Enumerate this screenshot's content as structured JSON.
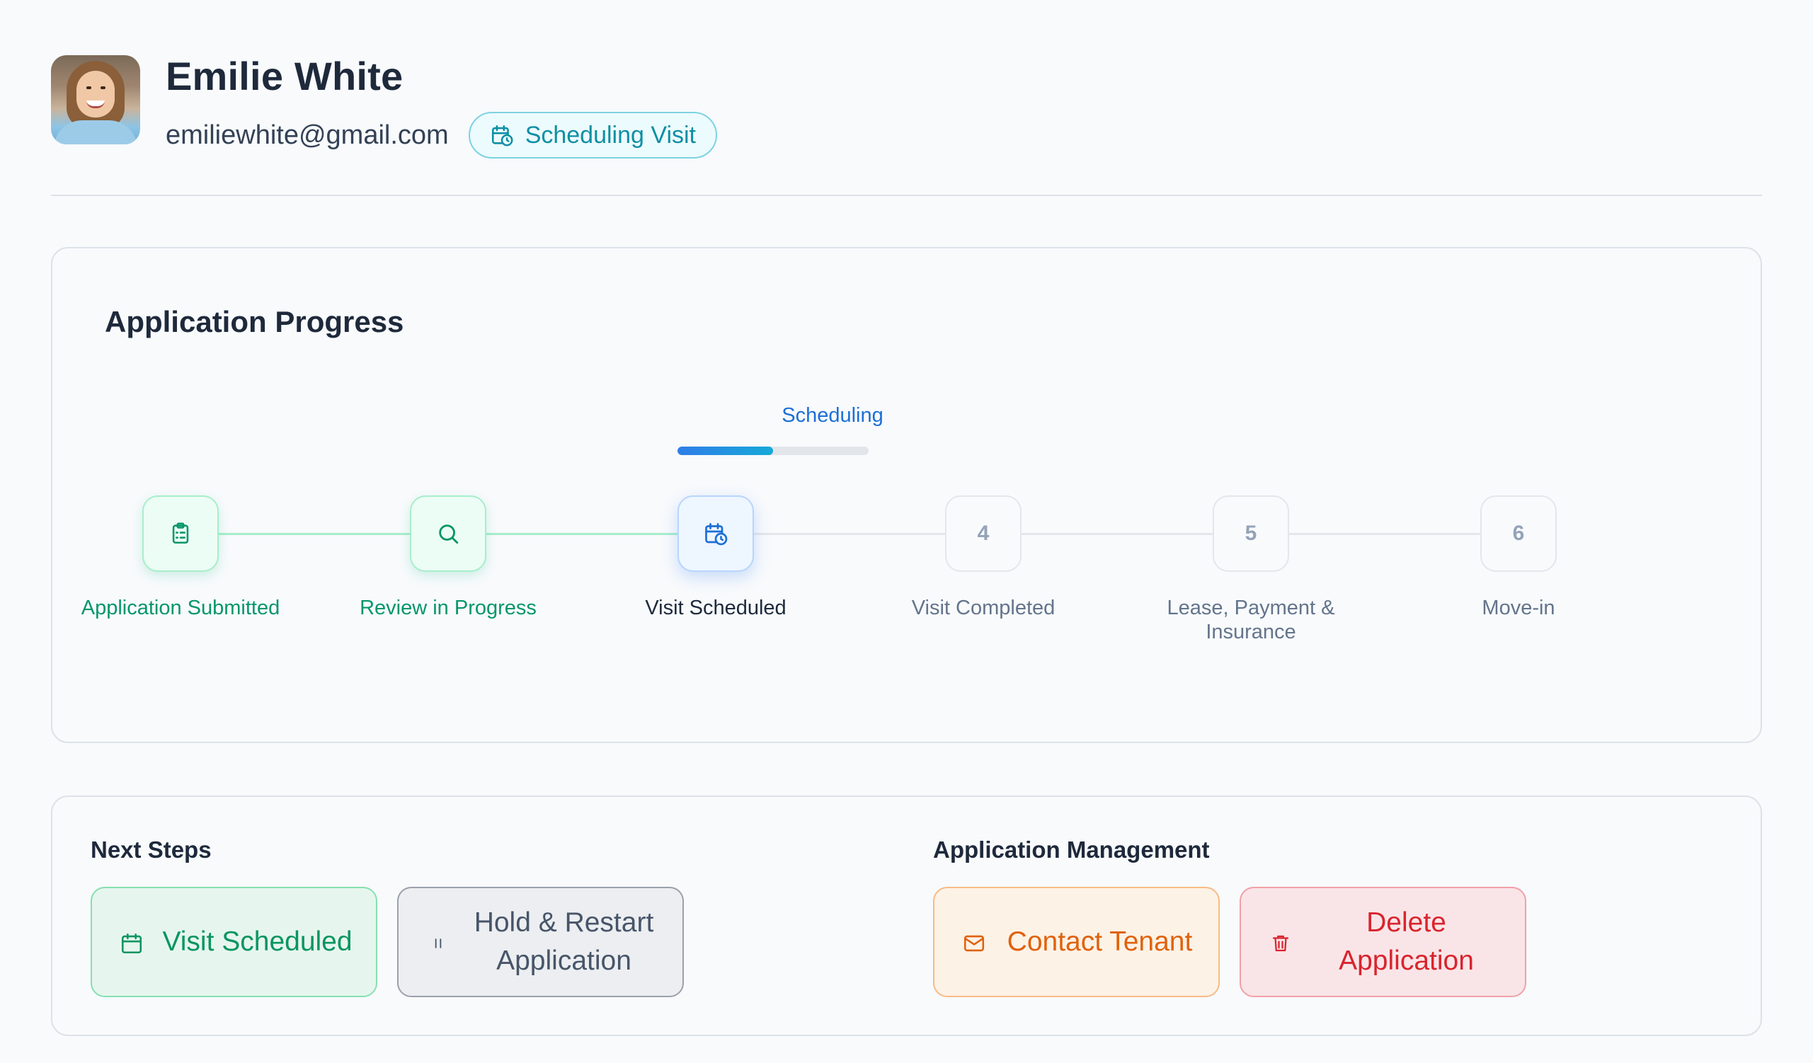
{
  "profile": {
    "name": "Emilie White",
    "email": "emiliewhite@gmail.com",
    "status": "Scheduling Visit"
  },
  "progress": {
    "title": "Application Progress",
    "current_phase": "Scheduling",
    "phase_progress": 0.5,
    "steps": [
      {
        "label": "Application Submitted",
        "state": "done",
        "icon": "clipboard-icon"
      },
      {
        "label": "Review in Progress",
        "state": "done",
        "icon": "search-icon"
      },
      {
        "label": "Visit Scheduled",
        "state": "active",
        "icon": "calendar-clock-icon"
      },
      {
        "label": "Visit Completed",
        "state": "todo",
        "number": "4"
      },
      {
        "label": "Lease, Payment & Insurance",
        "state": "todo",
        "number": "5"
      },
      {
        "label": "Move-in",
        "state": "todo",
        "number": "6"
      }
    ]
  },
  "next_steps": {
    "title": "Next Steps",
    "visit_scheduled_label": "Visit Scheduled",
    "hold_restart_label": "Hold & Restart Application"
  },
  "management": {
    "title": "Application Management",
    "contact_label": "Contact Tenant",
    "delete_label": "Delete Application"
  },
  "colors": {
    "done": "#059669",
    "active": "#1d6fd6",
    "status_accent": "#0e8fa5",
    "delete": "#d9242e",
    "contact": "#e0620d"
  }
}
